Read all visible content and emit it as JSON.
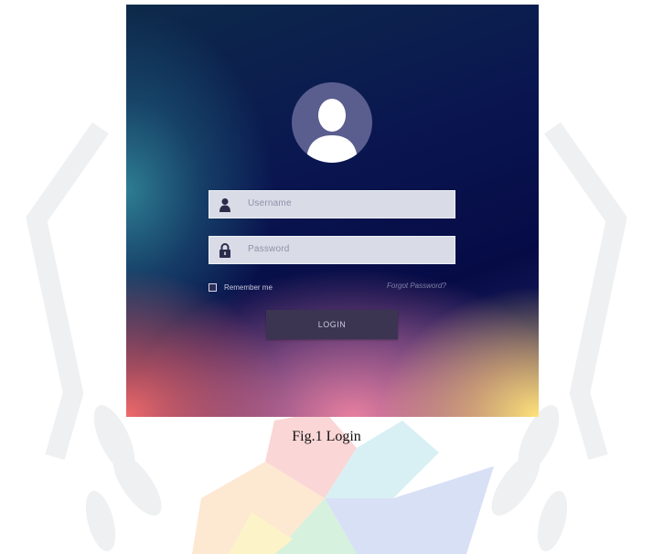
{
  "login": {
    "username_placeholder": "Username",
    "password_placeholder": "Password",
    "remember_label": "Remember me",
    "forgot_label": "Forgot Password?",
    "login_label": "LOGIN"
  },
  "figure": {
    "caption": "Fig.1 Login"
  },
  "icons": {
    "avatar": "user-avatar-icon",
    "username": "user-icon",
    "password": "lock-icon"
  },
  "colors": {
    "field_bg": "#d9dbe6",
    "button_bg": "#3b3552",
    "panel_top": "#060b46"
  }
}
